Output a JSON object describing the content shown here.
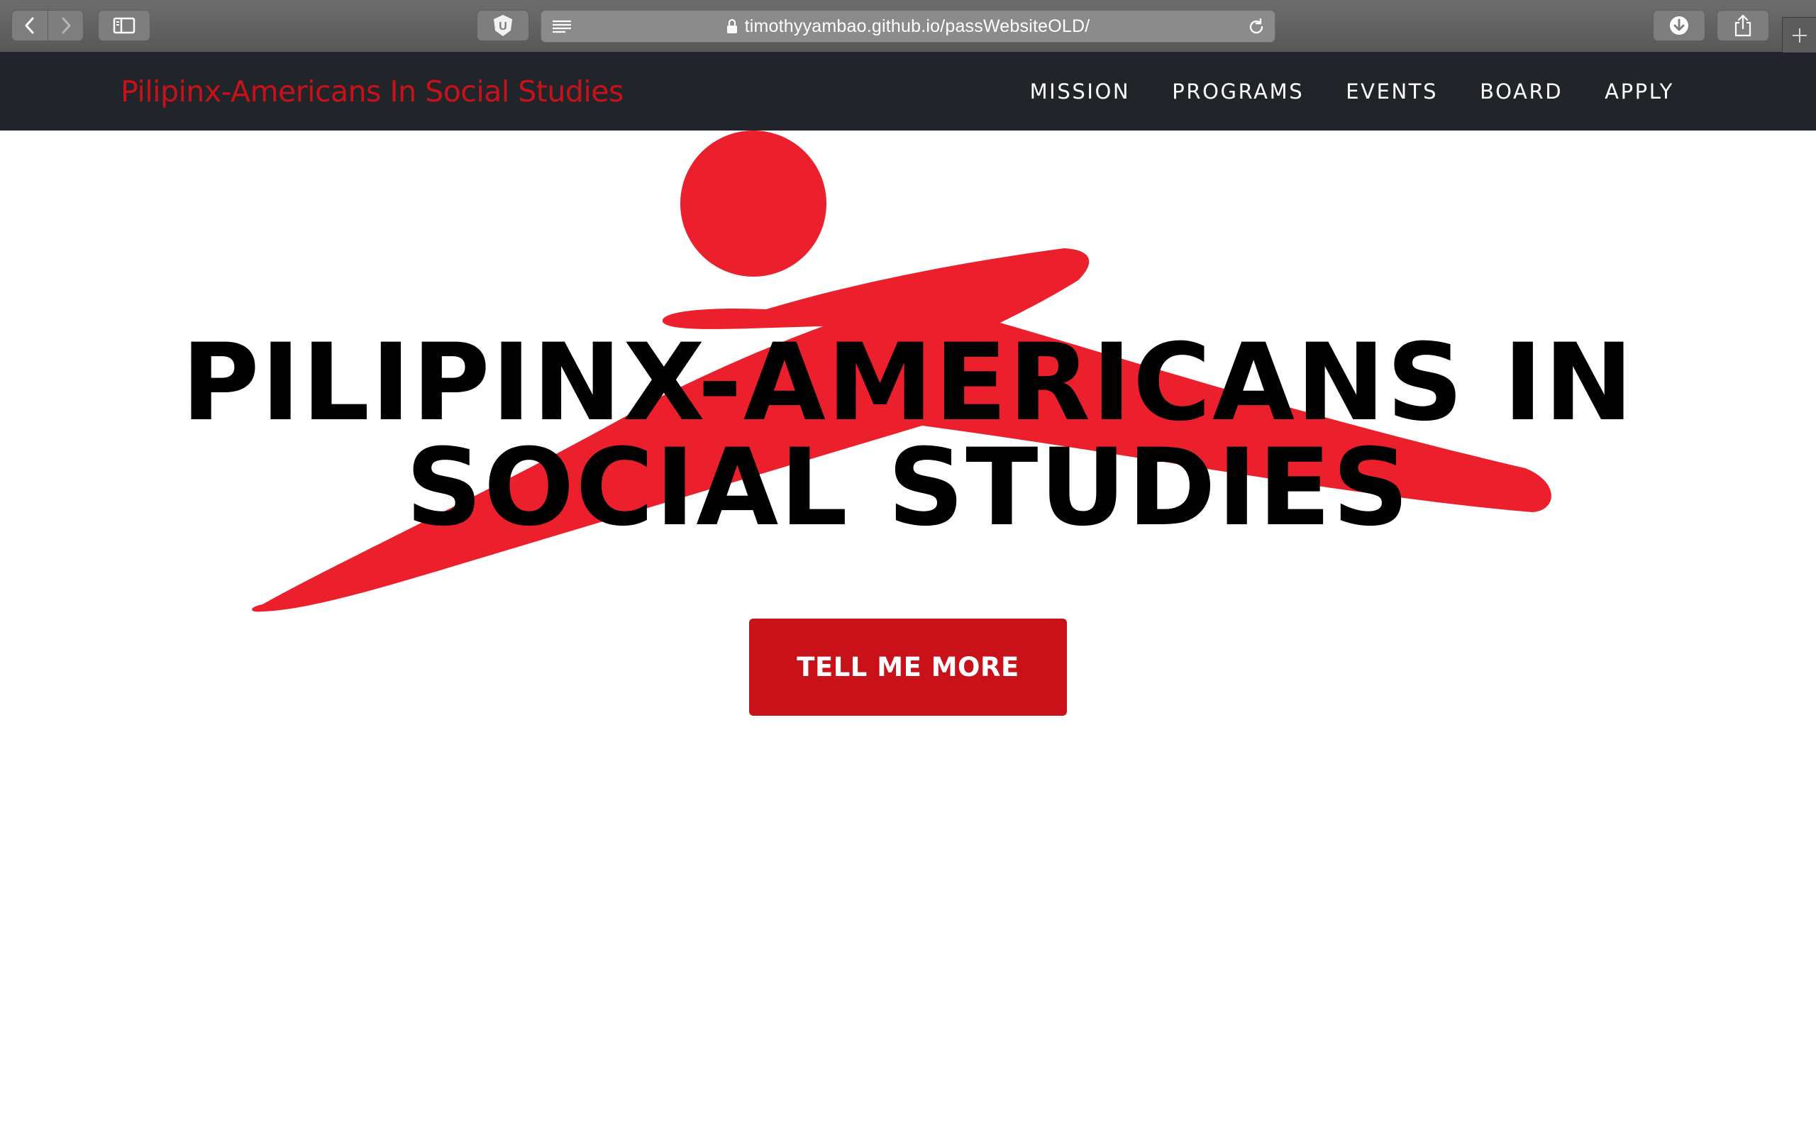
{
  "browser": {
    "url": "timothyyambao.github.io/passWebsiteOLD/",
    "extension_badge": "U"
  },
  "navbar": {
    "brand": "Pilipinx-Americans In Social Studies",
    "links": [
      {
        "label": "MISSION"
      },
      {
        "label": "PROGRAMS"
      },
      {
        "label": "EVENTS"
      },
      {
        "label": "BOARD"
      },
      {
        "label": "APPLY"
      }
    ]
  },
  "hero": {
    "heading_line1": "PILIPINX-AMERICANS IN",
    "heading_line2": "SOCIAL STUDIES",
    "cta_label": "TELL ME MORE"
  },
  "colors": {
    "accent": "#c9111a",
    "logo_red": "#ec1f2d",
    "navbar_bg": "#212529",
    "toolbar_bg": "#5f5f5f"
  },
  "icons": [
    "back-icon",
    "forward-icon",
    "sidebar-icon",
    "extension-icon",
    "reader-icon",
    "lock-icon",
    "reload-icon",
    "download-icon",
    "share-icon",
    "new-tab-icon"
  ]
}
